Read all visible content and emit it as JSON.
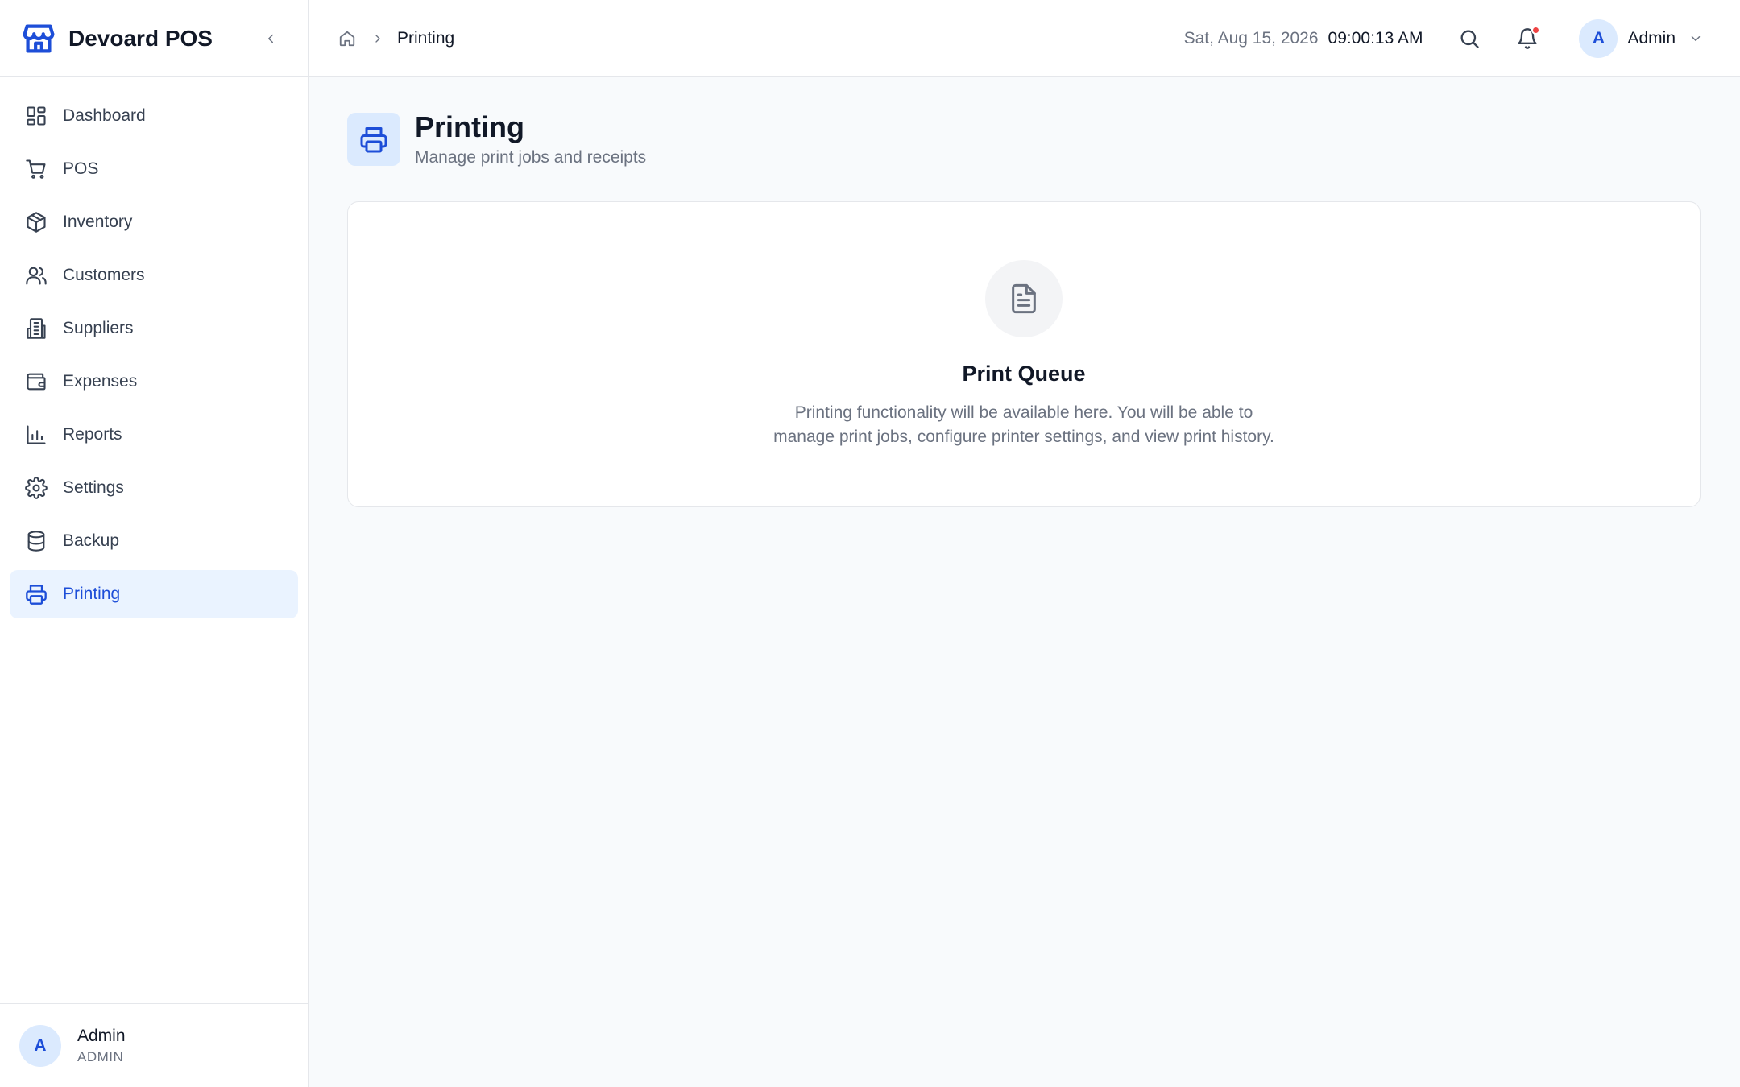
{
  "brand": {
    "name": "Devoard POS"
  },
  "sidebar": {
    "items": [
      {
        "label": "Dashboard",
        "icon": "dashboard-icon"
      },
      {
        "label": "POS",
        "icon": "cart-icon"
      },
      {
        "label": "Inventory",
        "icon": "package-icon"
      },
      {
        "label": "Customers",
        "icon": "users-icon"
      },
      {
        "label": "Suppliers",
        "icon": "building-icon"
      },
      {
        "label": "Expenses",
        "icon": "wallet-icon"
      },
      {
        "label": "Reports",
        "icon": "bar-chart-icon"
      },
      {
        "label": "Settings",
        "icon": "gear-icon"
      },
      {
        "label": "Backup",
        "icon": "database-icon"
      },
      {
        "label": "Printing",
        "icon": "printer-icon",
        "active": true
      }
    ],
    "footer": {
      "avatar_initial": "A",
      "name": "Admin",
      "role": "ADMIN"
    }
  },
  "topbar": {
    "breadcrumb": {
      "current": "Printing"
    },
    "date": "Sat, Aug 15, 2026",
    "time": "09:00:13 AM",
    "user": {
      "avatar_initial": "A",
      "name": "Admin"
    }
  },
  "page": {
    "title": "Printing",
    "subtitle": "Manage print jobs and receipts"
  },
  "card": {
    "title": "Print Queue",
    "line1": "Printing functionality will be available here. You will be able to",
    "line2": "manage print jobs, configure printer settings, and view print history."
  },
  "colors": {
    "accent": "#1d4ed8",
    "accent_soft": "#dbeafe",
    "active_bg": "#eaf3ff",
    "notification": "#ef4444"
  }
}
